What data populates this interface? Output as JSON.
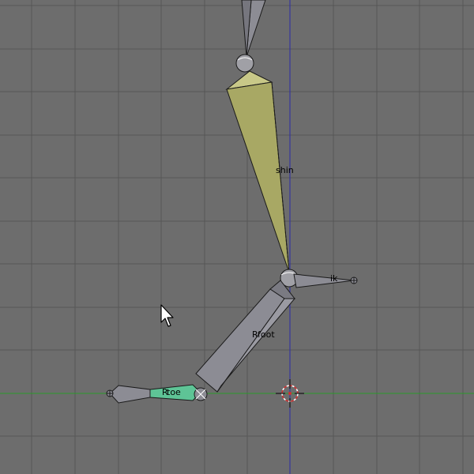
{
  "viewport": {
    "background_color": "#6d6d6d",
    "grid_color": "#5a5a5a",
    "x_axis_color": "#2b9a2b",
    "z_axis_color": "#2a2aa8"
  },
  "bones": {
    "thigh": {
      "label": "",
      "color": "#8c8c94"
    },
    "shin": {
      "label": "shin",
      "color": "#a8a864",
      "state": "selected"
    },
    "ik": {
      "label": "ik",
      "color": "#8c8c94"
    },
    "foot": {
      "label": "foot",
      "color": "#8c8c94"
    },
    "roll_foot": {
      "label": "R",
      "color": "#8c8c94"
    },
    "toe": {
      "label": "toe",
      "color": "#5ec496",
      "state": "active"
    },
    "roll_toe": {
      "label": "R",
      "color": "#8c8c94"
    }
  },
  "icons": {
    "cursor": "mouse-pointer-icon",
    "3d_cursor": "3d-cursor-icon"
  }
}
